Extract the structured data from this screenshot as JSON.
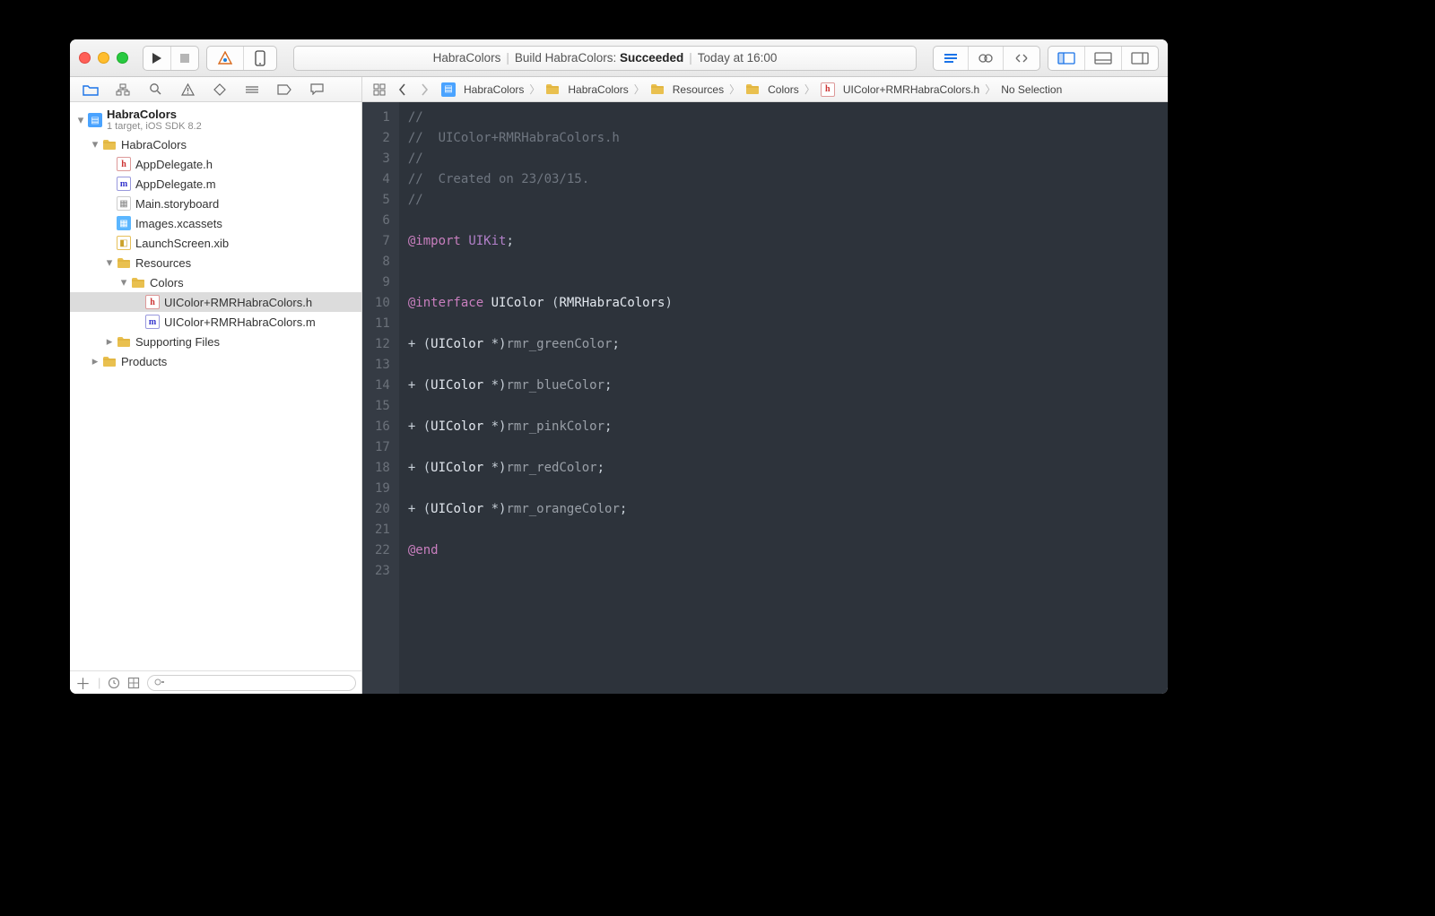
{
  "toolbar": {
    "status_project": "HabraColors",
    "status_scheme": "Build HabraColors:",
    "status_result": "Succeeded",
    "status_time": "Today at 16:00"
  },
  "breadcrumbs": [
    {
      "label": "HabraColors",
      "icon": "proj"
    },
    {
      "label": "HabraColors",
      "icon": "folder"
    },
    {
      "label": "Resources",
      "icon": "folder"
    },
    {
      "label": "Colors",
      "icon": "folder"
    },
    {
      "label": "UIColor+RMRHabraColors.h",
      "icon": "h"
    },
    {
      "label": "No Selection",
      "icon": "none"
    }
  ],
  "project": {
    "name": "HabraColors",
    "subtitle": "1 target, iOS SDK 8.2",
    "tree": [
      {
        "indent": 0,
        "disclose": "down",
        "icon": "proj",
        "label": "HabraColors",
        "subtitle": "1 target, iOS SDK 8.2",
        "bold": true
      },
      {
        "indent": 1,
        "disclose": "down",
        "icon": "folder",
        "label": "HabraColors"
      },
      {
        "indent": 2,
        "disclose": "none",
        "icon": "h",
        "label": "AppDelegate.h"
      },
      {
        "indent": 2,
        "disclose": "none",
        "icon": "m",
        "label": "AppDelegate.m"
      },
      {
        "indent": 2,
        "disclose": "none",
        "icon": "sb",
        "label": "Main.storyboard"
      },
      {
        "indent": 2,
        "disclose": "none",
        "icon": "assets",
        "label": "Images.xcassets"
      },
      {
        "indent": 2,
        "disclose": "none",
        "icon": "xib",
        "label": "LaunchScreen.xib"
      },
      {
        "indent": 2,
        "disclose": "down",
        "icon": "folder",
        "label": "Resources"
      },
      {
        "indent": 3,
        "disclose": "down",
        "icon": "folder",
        "label": "Colors"
      },
      {
        "indent": 4,
        "disclose": "none",
        "icon": "h",
        "label": "UIColor+RMRHabraColors.h",
        "selected": true
      },
      {
        "indent": 4,
        "disclose": "none",
        "icon": "m",
        "label": "UIColor+RMRHabraColors.m"
      },
      {
        "indent": 2,
        "disclose": "right",
        "icon": "folder",
        "label": "Supporting Files"
      },
      {
        "indent": 1,
        "disclose": "right",
        "icon": "folder",
        "label": "Products"
      }
    ]
  },
  "editor": {
    "lines": [
      {
        "n": 1,
        "html": "<span class='c-cmt'>//</span>"
      },
      {
        "n": 2,
        "html": "<span class='c-cmt'>//  UIColor+RMRHabraColors.h</span>"
      },
      {
        "n": 3,
        "html": "<span class='c-cmt'>//</span>"
      },
      {
        "n": 4,
        "html": "<span class='c-cmt'>//  Created on 23/03/15.</span>"
      },
      {
        "n": 5,
        "html": "<span class='c-cmt'>//</span>"
      },
      {
        "n": 6,
        "html": ""
      },
      {
        "n": 7,
        "html": "<span class='c-kw'>@import</span> <span class='c-lit'>UIKit</span>;"
      },
      {
        "n": 8,
        "html": ""
      },
      {
        "n": 9,
        "html": ""
      },
      {
        "n": 10,
        "html": "<span class='c-kw'>@interface</span> <span class='c-cls'>UIColor</span> (<span class='c-cls'>RMRHabraColors</span>)"
      },
      {
        "n": 11,
        "html": ""
      },
      {
        "n": 12,
        "html": "+ (<span class='c-cls'>UIColor</span> *)<span class='c-mth'>rmr_greenColor</span>;"
      },
      {
        "n": 13,
        "html": ""
      },
      {
        "n": 14,
        "html": "+ (<span class='c-cls'>UIColor</span> *)<span class='c-mth'>rmr_blueColor</span>;"
      },
      {
        "n": 15,
        "html": ""
      },
      {
        "n": 16,
        "html": "+ (<span class='c-cls'>UIColor</span> *)<span class='c-mth'>rmr_pinkColor</span>;"
      },
      {
        "n": 17,
        "html": ""
      },
      {
        "n": 18,
        "html": "+ (<span class='c-cls'>UIColor</span> *)<span class='c-mth'>rmr_redColor</span>;"
      },
      {
        "n": 19,
        "html": ""
      },
      {
        "n": 20,
        "html": "+ (<span class='c-cls'>UIColor</span> *)<span class='c-mth'>rmr_orangeColor</span>;"
      },
      {
        "n": 21,
        "html": ""
      },
      {
        "n": 22,
        "html": "<span class='c-kw'>@end</span>"
      },
      {
        "n": 23,
        "html": ""
      }
    ]
  },
  "colors": {
    "editor_bg": "#2d333b",
    "gutter_bg": "#353b44",
    "keyword": "#c97fbf",
    "comment": "#6f7680"
  }
}
